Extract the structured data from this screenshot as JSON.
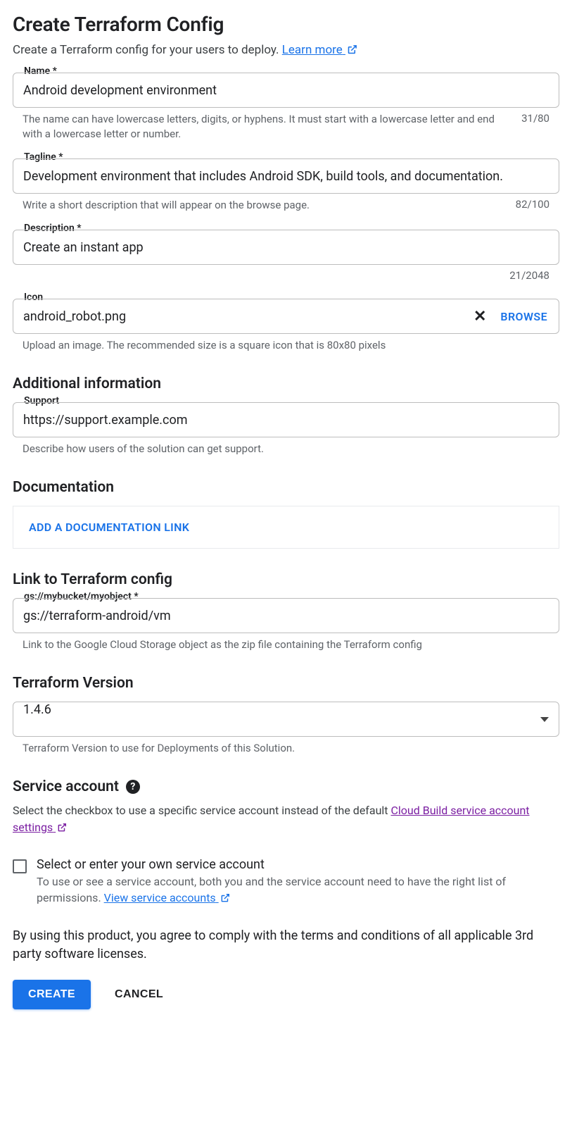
{
  "title": "Create Terraform Config",
  "intro_text": "Create a Terraform config for your users to deploy. ",
  "intro_link": "Learn more",
  "fields": {
    "name": {
      "label": "Name *",
      "value": "Android development environment",
      "helper": "The name can have lowercase letters, digits, or hyphens. It must start with a lowercase letter and end with a lowercase letter or number.",
      "counter": "31/80"
    },
    "tagline": {
      "label": "Tagline *",
      "value": "Development environment that includes Android SDK, build tools, and documentation.",
      "helper": "Write a short description that will appear on the browse page.",
      "counter": "82/100"
    },
    "description": {
      "label": "Description *",
      "value": "Create an instant app",
      "counter": "21/2048"
    },
    "icon": {
      "label": "Icon",
      "value": "android_robot.png",
      "browse": "BROWSE",
      "helper": "Upload an image. The recommended size is a square icon that is 80x80 pixels"
    },
    "support": {
      "label": "Support",
      "value": "https://support.example.com",
      "helper": "Describe how users of the solution can get support."
    },
    "tfconfig": {
      "label": "gs://mybucket/myobject *",
      "value": "gs://terraform-android/vm",
      "helper": "Link to the Google Cloud Storage object as the zip file containing the Terraform config"
    },
    "tfversion": {
      "value": "1.4.6",
      "helper": "Terraform Version to use for Deployments of this Solution."
    }
  },
  "sections": {
    "additional": "Additional information",
    "documentation": "Documentation",
    "link_tfconfig": "Link to Terraform config",
    "tfversion": "Terraform Version",
    "service_account": "Service account"
  },
  "doc_add": "ADD A DOCUMENTATION LINK",
  "service_account": {
    "desc_prefix": "Select the checkbox to use a specific service account instead of the default ",
    "desc_link": "Cloud Build service account settings",
    "checkbox_label": "Select or enter your own service account",
    "checkbox_sub_prefix": "To use or see a service account, both you and the service account need to have the right list of permissions. ",
    "checkbox_sub_link": "View service accounts"
  },
  "agreement": "By using this product, you agree to comply with the terms and conditions of all applicable 3rd party software licenses.",
  "actions": {
    "create": "CREATE",
    "cancel": "CANCEL"
  }
}
